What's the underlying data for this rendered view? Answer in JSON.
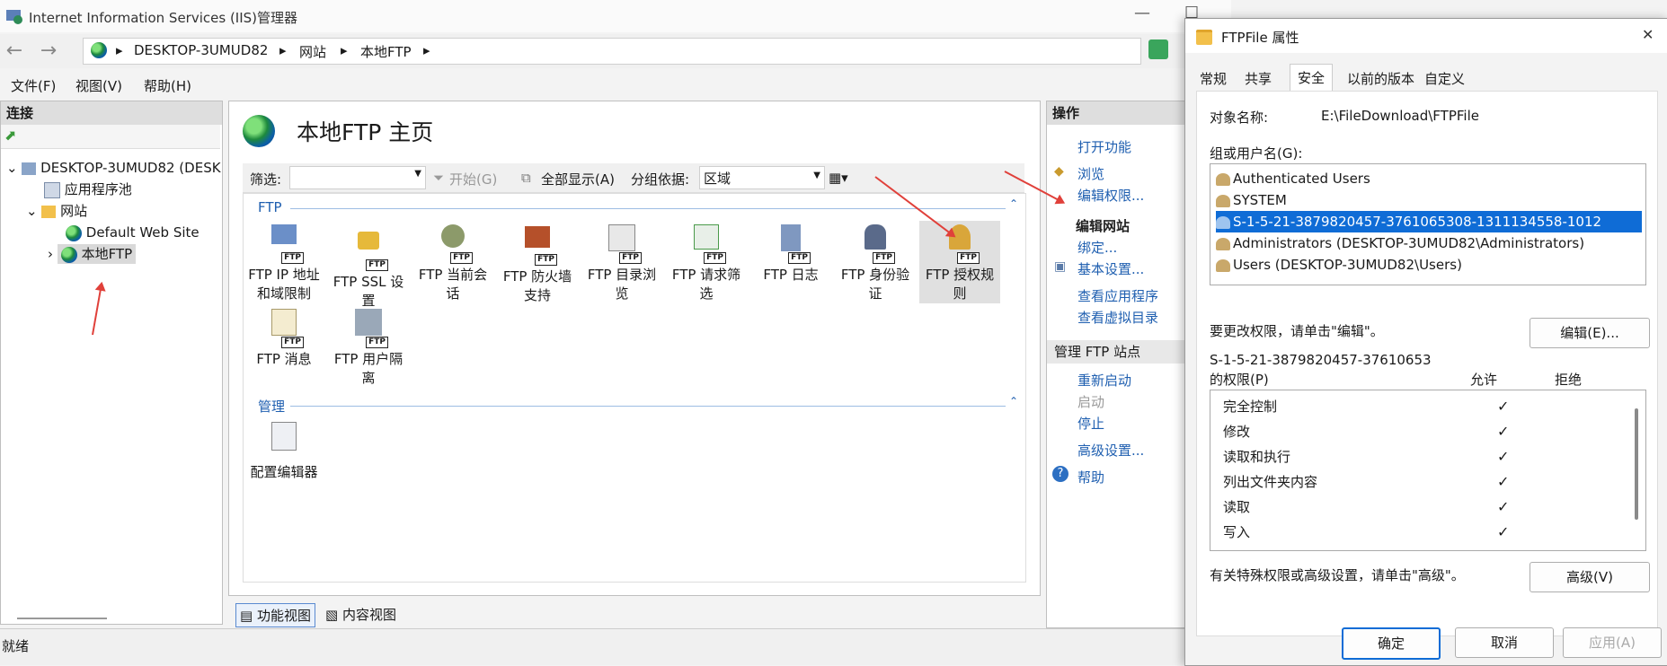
{
  "iis": {
    "title": "Internet Information Services (IIS)管理器",
    "breadcrumb": [
      "DESKTOP-3UMUD82",
      "网站",
      "本地FTP"
    ],
    "menu": [
      "文件(F)",
      "视图(V)",
      "帮助(H)"
    ],
    "connections": {
      "header": "连接",
      "tree": [
        "DESKTOP-3UMUD82 (DESK",
        "应用程序池",
        "网站",
        "Default Web Site",
        "本地FTP"
      ]
    },
    "main": {
      "title": "本地FTP 主页",
      "filter_label": "筛选:",
      "start_label": "开始(G)",
      "show_all_label": "全部显示(A)",
      "group_label": "分组依据:",
      "group_value": "区域",
      "section_ftp": "FTP",
      "section_manage": "管理",
      "features": [
        {
          "line1": "FTP IP 地址",
          "line2": "和域限制"
        },
        {
          "line1": "FTP SSL 设",
          "line2": "置"
        },
        {
          "line1": "FTP 当前会",
          "line2": "话"
        },
        {
          "line1": "FTP 防火墙",
          "line2": "支持"
        },
        {
          "line1": "FTP 目录浏",
          "line2": "览"
        },
        {
          "line1": "FTP 请求筛",
          "line2": "选"
        },
        {
          "line1": "FTP 日志",
          "line2": ""
        },
        {
          "line1": "FTP 身份验",
          "line2": "证"
        },
        {
          "line1": "FTP 授权规",
          "line2": "则"
        },
        {
          "line1": "FTP 消息",
          "line2": ""
        },
        {
          "line1": "FTP 用户隔",
          "line2": "离"
        }
      ],
      "manage_features": [
        "配置编辑器"
      ],
      "view_tabs": [
        "功能视图",
        "内容视图"
      ]
    },
    "actions": {
      "header": "操作",
      "items": [
        "打开功能",
        "浏览",
        "编辑权限...",
        "编辑网站",
        "绑定...",
        "基本设置...",
        "查看应用程序",
        "查看虚拟目录",
        "管理 FTP 站点",
        "重新启动",
        "启动",
        "停止",
        "高级设置...",
        "帮助"
      ]
    },
    "status": "就绪",
    "badge_text": "FTP"
  },
  "dialog": {
    "title": "FTPFile 属性",
    "tabs": [
      "常规",
      "共享",
      "安全",
      "以前的版本",
      "自定义"
    ],
    "object_label": "对象名称:",
    "object_value": "E:\\FileDownload\\FTPFile",
    "group_label": "组或用户名(G):",
    "users": [
      "Authenticated Users",
      "SYSTEM",
      "S-1-5-21-3879820457-3761065308-1311134558-1012",
      "Administrators (DESKTOP-3UMUD82\\Administrators)",
      "Users (DESKTOP-3UMUD82\\Users)"
    ],
    "edit_hint": "要更改权限，请单击\"编辑\"。",
    "edit_button": "编辑(E)...",
    "perm_for_line1": "S-1-5-21-3879820457-37610653",
    "perm_for_line2": "的权限(P)",
    "allow_label": "允许",
    "deny_label": "拒绝",
    "permissions": [
      "完全控制",
      "修改",
      "读取和执行",
      "列出文件夹内容",
      "读取",
      "写入"
    ],
    "check_mark": "✓",
    "advanced_hint": "有关特殊权限或高级设置，请单击\"高级\"。",
    "advanced_button": "高级(V)",
    "ok_button": "确定",
    "cancel_button": "取消",
    "apply_button": "应用(A)",
    "close_glyph": "✕"
  },
  "colors": {
    "accent": "#0f6cd6",
    "link": "#1f5fb0",
    "annotation": "#e0403a"
  }
}
